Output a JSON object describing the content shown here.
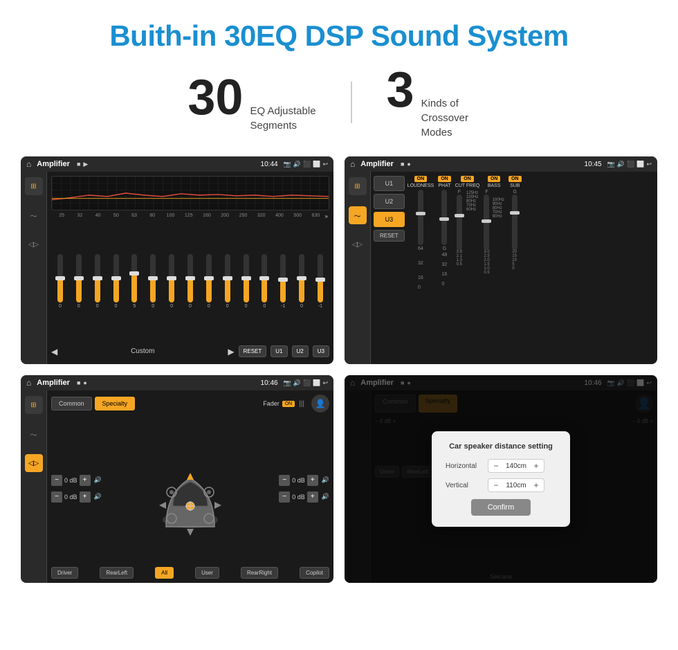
{
  "title": "Buith-in 30EQ DSP Sound System",
  "stats": {
    "eq": {
      "number": "30",
      "desc": "EQ Adjustable\nSegments"
    },
    "crossover": {
      "number": "3",
      "desc": "Kinds of\nCrossover Modes"
    }
  },
  "screens": {
    "s1": {
      "title": "Amplifier",
      "time": "10:44",
      "eq_labels": [
        "25",
        "32",
        "40",
        "50",
        "63",
        "80",
        "100",
        "125",
        "160",
        "200",
        "250",
        "320",
        "400",
        "500",
        "630"
      ],
      "eq_values": [
        0,
        0,
        0,
        0,
        5,
        0,
        0,
        0,
        0,
        0,
        0,
        0,
        -1,
        0,
        -1
      ],
      "preset": "Custom",
      "buttons": [
        "RESET",
        "U1",
        "U2",
        "U3"
      ]
    },
    "s2": {
      "title": "Amplifier",
      "time": "10:45",
      "units": [
        "U1",
        "U2",
        "U3"
      ],
      "active_unit": "U3",
      "sections": [
        "LOUDNESS",
        "PHAT",
        "CUT FREQ",
        "BASS",
        "SUB"
      ],
      "reset_label": "RESET"
    },
    "s3": {
      "title": "Amplifier",
      "time": "10:46",
      "tabs": [
        "Common",
        "Specialty"
      ],
      "fader_label": "Fader",
      "fader_on": "ON",
      "db_values": [
        "0 dB",
        "0 dB",
        "0 dB",
        "0 dB"
      ],
      "positions": [
        "Driver",
        "RearLeft",
        "All",
        "User",
        "RearRight",
        "Copilot"
      ]
    },
    "s4": {
      "title": "Amplifier",
      "time": "10:46",
      "dialog": {
        "title": "Car speaker distance setting",
        "horizontal_label": "Horizontal",
        "horizontal_value": "140cm",
        "vertical_label": "Vertical",
        "vertical_value": "110cm",
        "confirm_label": "Confirm"
      },
      "watermark": "Seicane"
    }
  }
}
